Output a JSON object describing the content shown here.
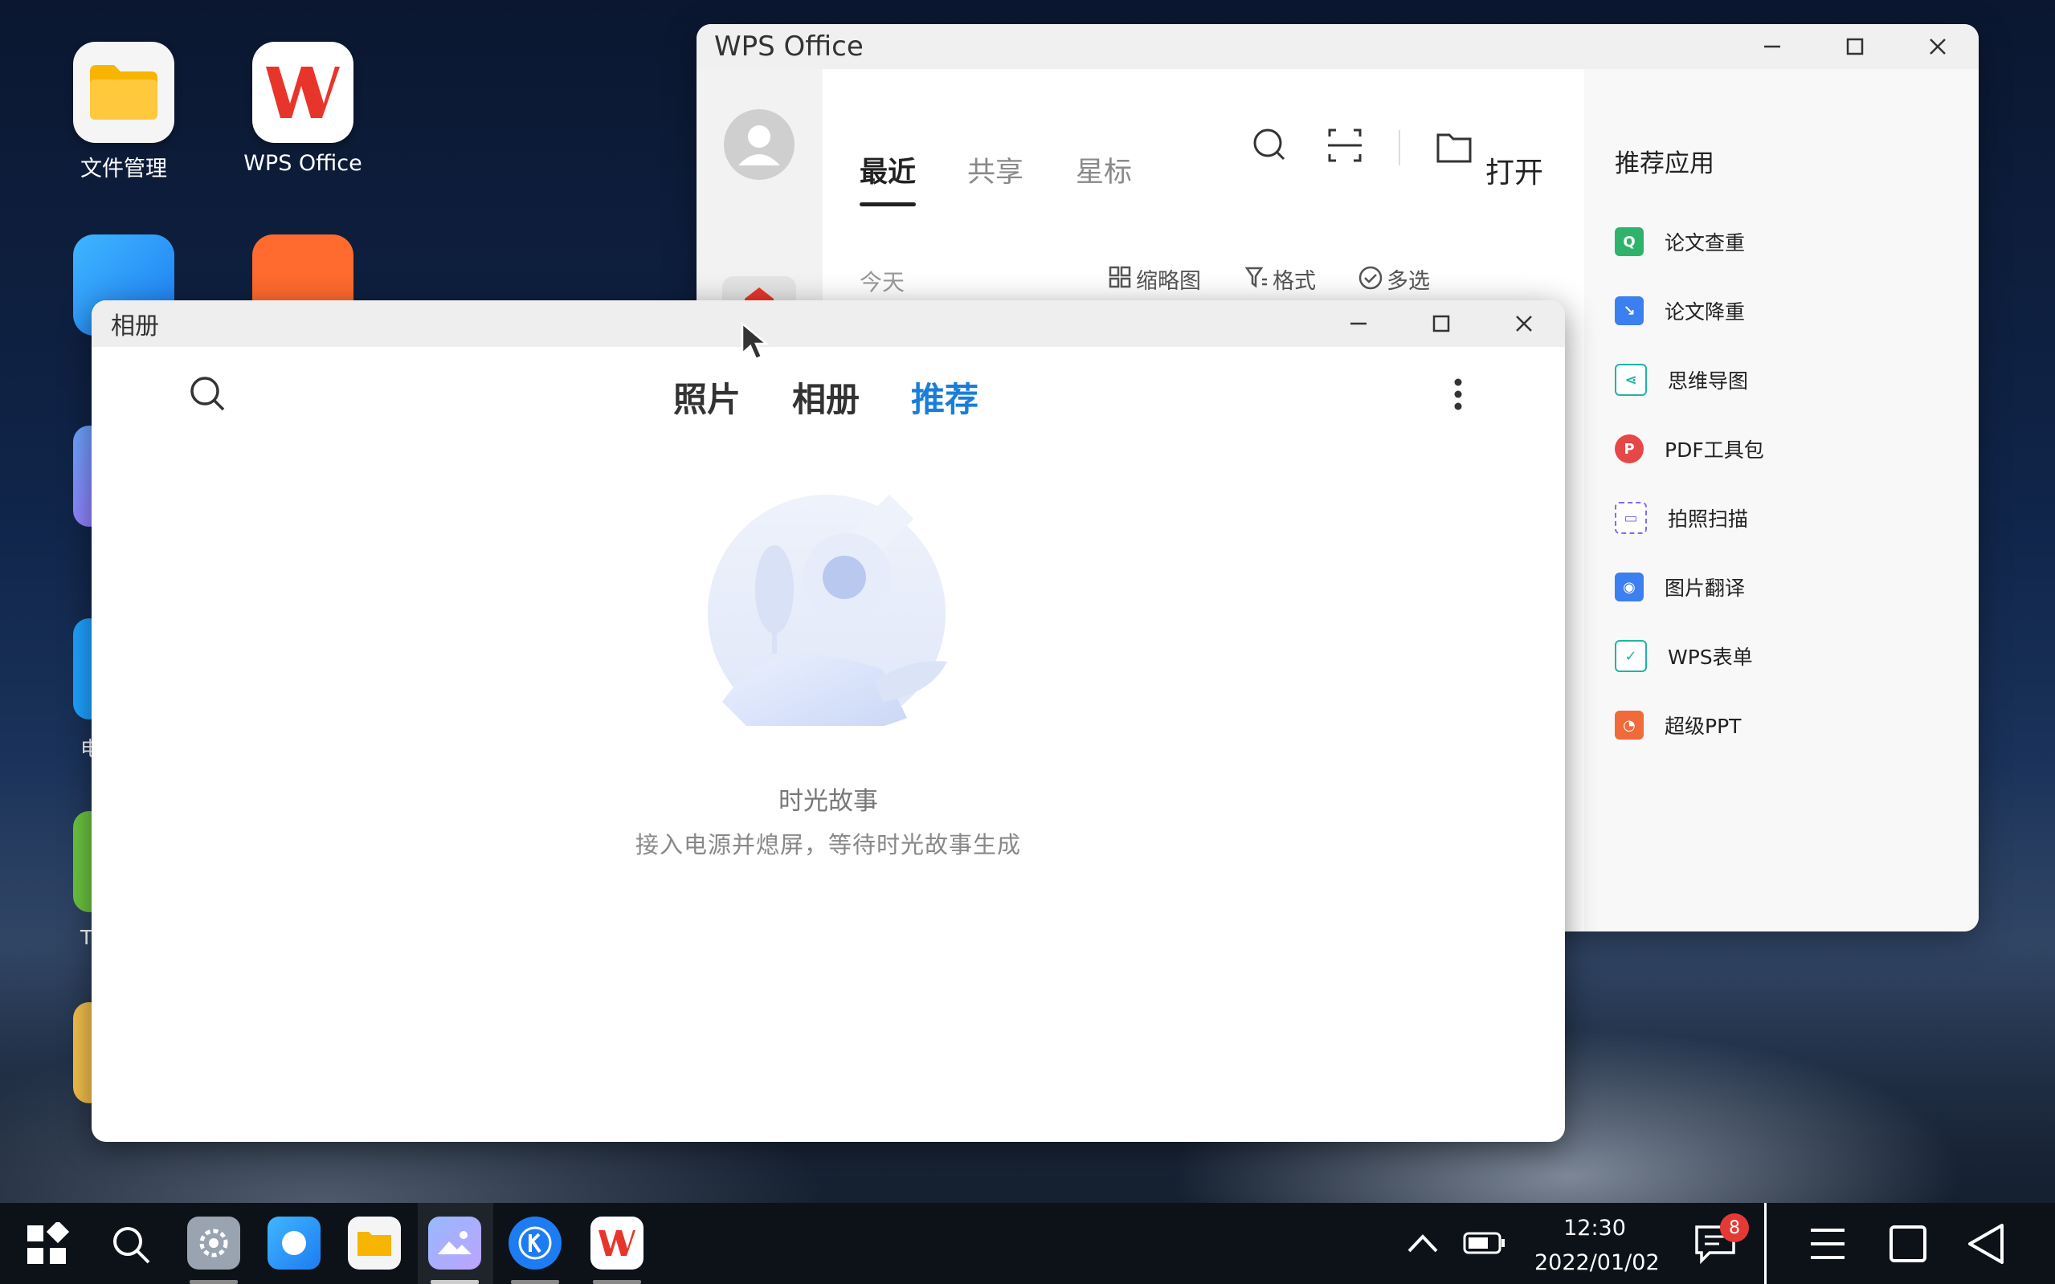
{
  "desktop": {
    "icons": [
      {
        "label": "文件管理",
        "icon": "folder-icon"
      },
      {
        "label": "WPS Office",
        "icon": "wps-icon"
      }
    ],
    "peek_label_1": "电",
    "peek_label_2": "T"
  },
  "wps": {
    "title": "WPS Office",
    "tabs": [
      "最近",
      "共享",
      "星标"
    ],
    "active_tab": "最近",
    "open_label": "打开",
    "section_today": "今天",
    "view_thumbnail": "缩略图",
    "view_format": "格式",
    "view_multiselect": "多选",
    "recommend_title": "推荐应用",
    "recommend_items": [
      {
        "label": "论文查重",
        "icon": "paper-check-icon",
        "color": "#2fb36b"
      },
      {
        "label": "论文降重",
        "icon": "paper-reduce-icon",
        "color": "#3c7ff0"
      },
      {
        "label": "思维导图",
        "icon": "mindmap-icon",
        "color": "#20b3a8"
      },
      {
        "label": "PDF工具包",
        "icon": "pdf-toolkit-icon",
        "color": "#e84747"
      },
      {
        "label": "拍照扫描",
        "icon": "photo-scan-icon",
        "color": "#7b6ff0"
      },
      {
        "label": "图片翻译",
        "icon": "image-translate-icon",
        "color": "#3c7ff0"
      },
      {
        "label": "WPS表单",
        "icon": "wps-form-icon",
        "color": "#20b3a8"
      },
      {
        "label": "超级PPT",
        "icon": "super-ppt-icon",
        "color": "#f06a3a"
      }
    ]
  },
  "gallery": {
    "title": "相册",
    "tabs": [
      "照片",
      "相册",
      "推荐"
    ],
    "active_tab": "推荐",
    "empty_title": "时光故事",
    "empty_subtitle": "接入电源并熄屏，等待时光故事生成"
  },
  "taskbar": {
    "time": "12:30",
    "date": "2022/01/02",
    "notification_count": "8"
  },
  "colors": {
    "accent": "#1a7ed8",
    "wps_red": "#e8352b"
  }
}
